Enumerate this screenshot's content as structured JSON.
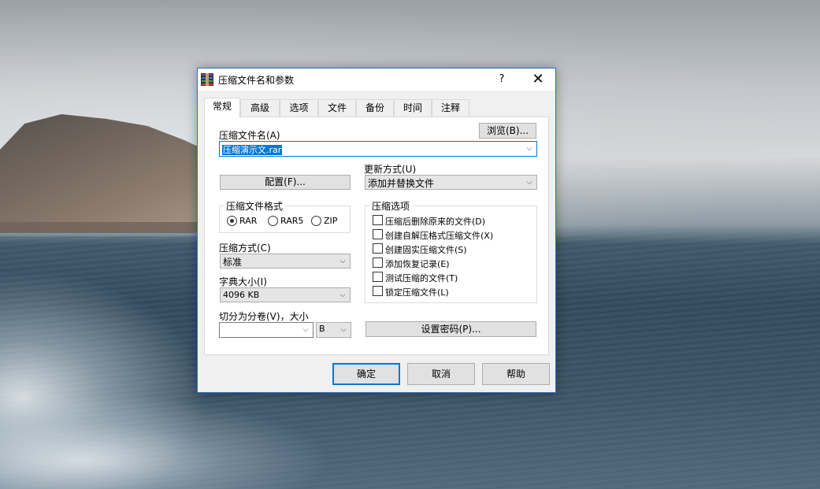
{
  "window": {
    "title": "压缩文件名和参数",
    "help": "?",
    "close": "✕"
  },
  "tabs": [
    "常规",
    "高级",
    "选项",
    "文件",
    "备份",
    "时间",
    "注释"
  ],
  "general": {
    "archive_name_label": "压缩文件名(A)",
    "browse_button": "浏览(B)...",
    "archive_name_value": "压缩演示文.rar",
    "profiles_button": "配置(F)...",
    "update_mode_label": "更新方式(U)",
    "update_mode_value": "添加并替换文件",
    "format_group_title": "压缩文件格式",
    "formats": [
      "RAR",
      "RAR5",
      "ZIP"
    ],
    "selected_format": "RAR",
    "method_label": "压缩方式(C)",
    "method_value": "标准",
    "dict_label": "字典大小(I)",
    "dict_value": "4096 KB",
    "split_label": "切分为分卷(V)，大小",
    "split_value": "",
    "split_unit": "B",
    "options_group_title": "压缩选项",
    "options": [
      "压缩后删除原来的文件(D)",
      "创建自解压格式压缩文件(X)",
      "创建固实压缩文件(S)",
      "添加恢复记录(E)",
      "测试压缩的文件(T)",
      "锁定压缩文件(L)"
    ],
    "password_button": "设置密码(P)..."
  },
  "buttons": {
    "ok": "确定",
    "cancel": "取消",
    "help": "帮助"
  },
  "colors": {
    "accent": "#0078d7",
    "dialog_border": "#2b6fc2"
  }
}
